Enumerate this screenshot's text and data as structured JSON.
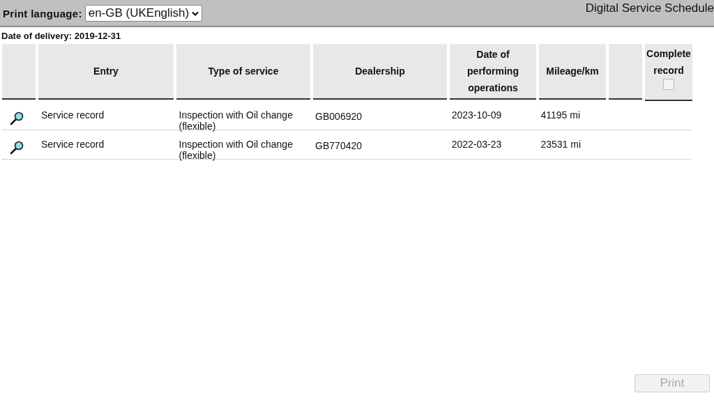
{
  "header": {
    "language_label": "Print language:",
    "language_value": "en-GB (UKEnglish)",
    "title": "Digital Service Schedule"
  },
  "delivery": "Date of delivery: 2019-12-31",
  "table": {
    "columns": [
      "",
      "Entry",
      "Type of service",
      "Dealership",
      "Date of performing operations",
      "Mileage/km",
      "",
      "Complete record"
    ],
    "complete_checkbox": {
      "checked": false
    },
    "rows": [
      {
        "entry": "Service record",
        "type": "Inspection with Oil change (flexible)",
        "dealership": "GB006920",
        "date": "2023-10-09",
        "mileage": "41195 mi"
      },
      {
        "entry": "Service record",
        "type": "Inspection with Oil change (flexible)",
        "dealership": "GB770420",
        "date": "2022-03-23",
        "mileage": "23531 mi"
      }
    ]
  },
  "print_button": {
    "label": "Print",
    "disabled": true
  }
}
